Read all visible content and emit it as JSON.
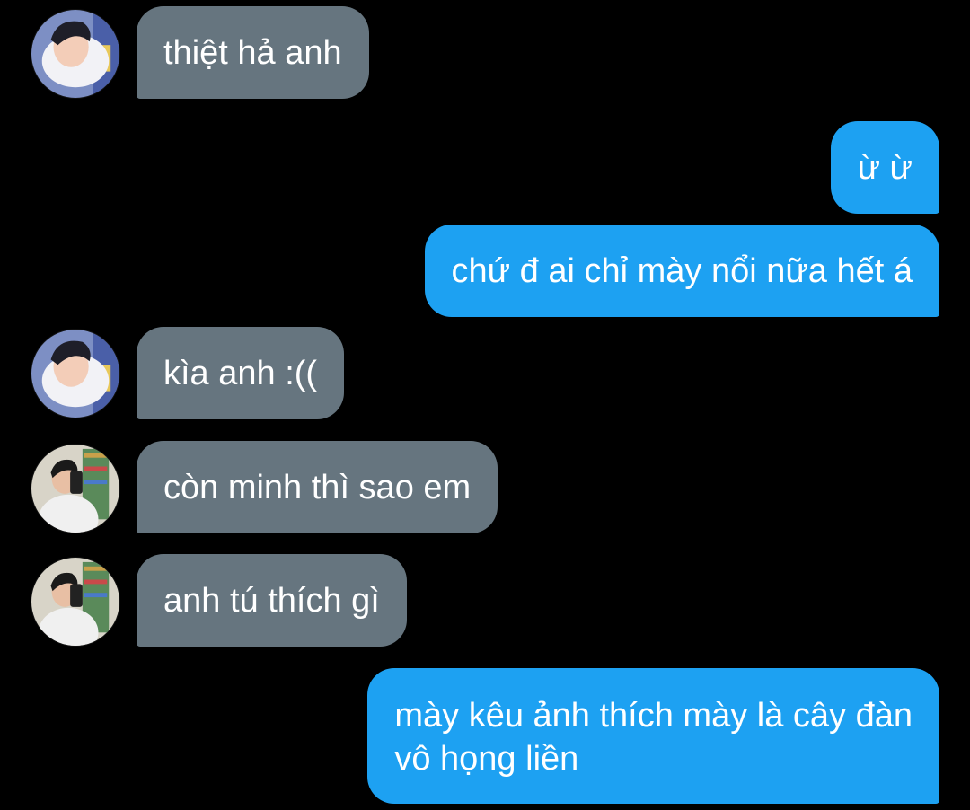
{
  "conversation": {
    "messages": [
      {
        "direction": "in",
        "sender_avatar": "avatar-a",
        "text": "thiệt hả anh"
      },
      {
        "direction": "out",
        "text": "ừ ừ"
      },
      {
        "direction": "out",
        "text": "chứ đ ai chỉ mày nổi nữa hết á"
      },
      {
        "direction": "in",
        "sender_avatar": "avatar-a",
        "text": "kìa anh :(("
      },
      {
        "direction": "in",
        "sender_avatar": "avatar-b",
        "text": "còn minh thì sao em"
      },
      {
        "direction": "in",
        "sender_avatar": "avatar-b",
        "text": "anh tú thích gì"
      },
      {
        "direction": "out",
        "lines": [
          "mày kêu ảnh thích mày là cây đàn",
          "vô họng liền"
        ]
      }
    ]
  },
  "colors": {
    "background": "#000000",
    "incoming_bubble": "#66757f",
    "outgoing_bubble": "#1da1f2",
    "text": "#ffffff"
  }
}
